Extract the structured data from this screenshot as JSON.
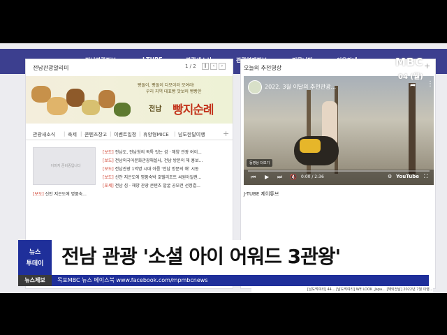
{
  "nav": {
    "items": [
      "전남관광정보",
      "J-TUBE",
      "관광새소식",
      "관광연계정보",
      "커뮤니티",
      "이용안내"
    ]
  },
  "left_panel": {
    "title": "전남관광알리미",
    "pager": "1 / 2",
    "banner": {
      "sub1": "빵돌이, 빵돌이 다모이라 모여라!",
      "sub2": "우리 지역 대표빵 맛보러 빵빵한",
      "region": "전남",
      "title": "빵지순례"
    },
    "tabs": [
      "관광새소식",
      "축제",
      "콘텐츠장고",
      "이벤트일정",
      "휴양형MICE",
      "남도한달여행"
    ],
    "thumb_text": "이미지 준비중입니다",
    "news": [
      {
        "cat": "[보도]",
        "text": "전남도, 전남형의 독특 잇는 섬 · 해양 관광 여이..."
      },
      {
        "cat": "[보도]",
        "text": "전남외국어문화관광해설사, 전남 방문의 해 홍보..."
      },
      {
        "cat": "[보도]",
        "text": "전남관광 1억명 시대 아름 '전남 방문의 해' 시동"
      },
      {
        "cat": "[보도]",
        "text": "신안 지은도에 명품숙박 호텔리조트 씨원아일랜..."
      },
      {
        "cat": "[포세]",
        "text": "전남 섬 · 해양 관광 콘텐츠 발굴 공모전 선정결..."
      },
      {
        "cat": "[보도]",
        "text": "신안 지은도에 명품숙..."
      }
    ]
  },
  "right_panel": {
    "title": "오늘의 추천영상",
    "video": {
      "title": "2022. 3월 이달의 추천관광...",
      "time": "0:00 / 2:36",
      "more": "동영상 더보기",
      "platform": "YouTube",
      "progress": 0.0
    },
    "jtube_label": "J-TUBE 제이튜브"
  },
  "broadcast": {
    "logo": "MBC",
    "date": "04 (월)",
    "badge_line1": "뉴스",
    "badge_line2": "투데이",
    "headline": "전남 관광 '소셜 아이 어워드 3관왕'",
    "ticker_label": "뉴스제보",
    "ticker_text": "목포MBC 뉴스 페이스북 www.facebook.com/mpmbcnews",
    "footer_items": "[남도먹여리] 44...   [남도먹여리] WE LOOK ,Japa...   [해외전남] 2022년 7월 이영..."
  }
}
